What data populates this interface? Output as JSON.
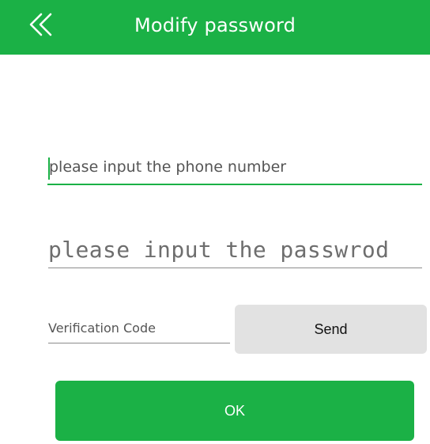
{
  "colors": {
    "brand_green": "#1bb146",
    "send_button_bg": "#e2e2e2",
    "underline_gray": "#8c8c8c",
    "background": "#ffffff"
  },
  "header": {
    "back_icon": "double-chevron-left-icon",
    "title": "Modify password"
  },
  "form": {
    "phone": {
      "value": "",
      "placeholder": "please input the phone number"
    },
    "password": {
      "value": "",
      "placeholder": "please input the passwrod"
    },
    "verification_code": {
      "value": "",
      "placeholder": "Verification Code"
    },
    "send_label": "Send",
    "ok_label": "OK"
  }
}
